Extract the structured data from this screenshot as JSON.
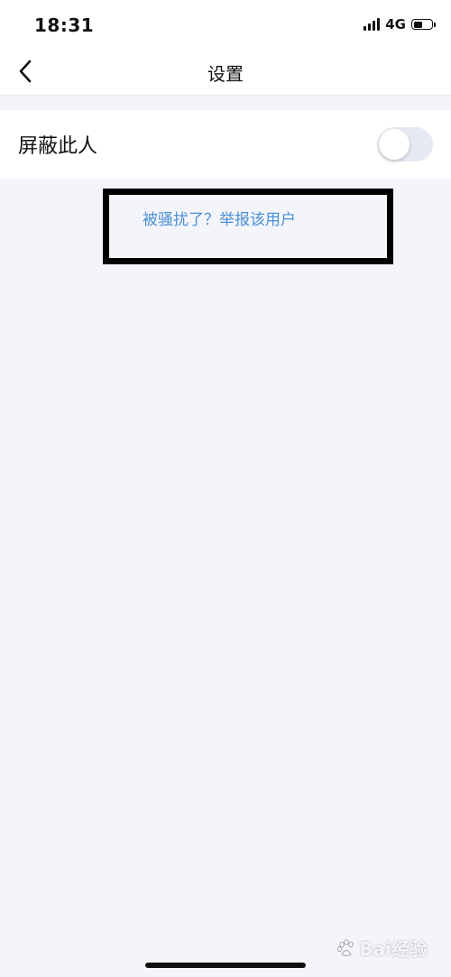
{
  "status_bar": {
    "time": "18:31",
    "network": "4G",
    "battery_level": 0.5
  },
  "nav": {
    "title": "设置",
    "back_icon": "chevron-left-icon"
  },
  "settings": {
    "block_user": {
      "label": "屏蔽此人",
      "enabled": false
    }
  },
  "report_link": {
    "label": "被骚扰了？举报该用户",
    "color": "#4a8fd8"
  },
  "watermark": {
    "text": "Bai经验",
    "icon": "baidu-paw-icon"
  },
  "colors": {
    "background": "#f4f5fa",
    "toggle_off": "#e6e8f2",
    "link": "#4a8fd8"
  }
}
